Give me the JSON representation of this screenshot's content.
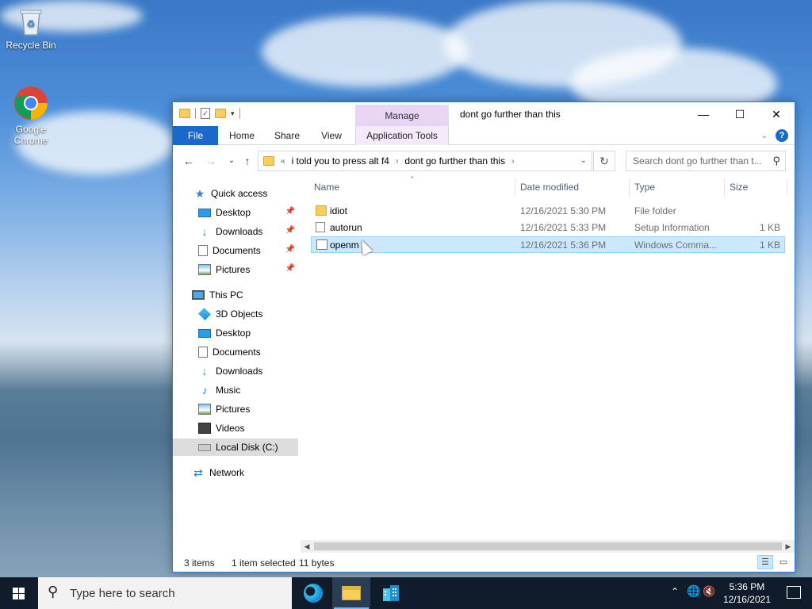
{
  "desktop": {
    "icons": [
      {
        "label": "Recycle Bin"
      },
      {
        "label": "Google Chrome"
      }
    ]
  },
  "window": {
    "title": "dont go further than this",
    "context_tab": "Manage",
    "ribbon_tabs": [
      "File",
      "Home",
      "Share",
      "View",
      "Application Tools"
    ],
    "controls": {
      "minimize": "—",
      "maximize": "☐",
      "close": "✕"
    }
  },
  "navigation": {
    "back": "←",
    "forward": "→",
    "recent": "⌄",
    "up": "↑",
    "address": {
      "overflow": "«",
      "crumbs": [
        "i told you to press alt f4",
        "dont go further than this"
      ]
    },
    "refresh": "↻",
    "search_placeholder": "Search dont go further than t..."
  },
  "nav_pane": {
    "quick_access": {
      "label": "Quick access",
      "items": [
        {
          "label": "Desktop",
          "icon": "desktop-icon",
          "pinned": true
        },
        {
          "label": "Downloads",
          "icon": "downloads-icon",
          "pinned": true
        },
        {
          "label": "Documents",
          "icon": "documents-icon",
          "pinned": true
        },
        {
          "label": "Pictures",
          "icon": "pictures-icon",
          "pinned": true
        }
      ]
    },
    "this_pc": {
      "label": "This PC",
      "items": [
        {
          "label": "3D Objects"
        },
        {
          "label": "Desktop"
        },
        {
          "label": "Documents"
        },
        {
          "label": "Downloads"
        },
        {
          "label": "Music"
        },
        {
          "label": "Pictures"
        },
        {
          "label": "Videos"
        },
        {
          "label": "Local Disk (C:)",
          "selected": true
        }
      ]
    },
    "network": {
      "label": "Network"
    }
  },
  "file_list": {
    "columns": [
      "Name",
      "Date modified",
      "Type",
      "Size"
    ],
    "rows": [
      {
        "name": "idiot",
        "date": "12/16/2021 5:30 PM",
        "type": "File folder",
        "size": "",
        "icon": "folder-icon",
        "selected": false
      },
      {
        "name": "autorun",
        "date": "12/16/2021 5:33 PM",
        "type": "Setup Information",
        "size": "1 KB",
        "icon": "setup-file-icon",
        "selected": false
      },
      {
        "name": "openm",
        "date": "12/16/2021 5:36 PM",
        "type": "Windows Comma...",
        "size": "1 KB",
        "icon": "cmd-file-icon",
        "selected": true
      }
    ]
  },
  "status_bar": {
    "items_count": "3 items",
    "selection": "1 item selected",
    "size": "11 bytes"
  },
  "taskbar": {
    "search_placeholder": "Type here to search",
    "clock_time": "5:36 PM",
    "clock_date": "12/16/2021"
  },
  "colors": {
    "accent": "#1a68c8",
    "selection_bg": "#cce8ff",
    "manage_tab": "#e8d4f5",
    "taskbar": "#0f1c2c"
  }
}
